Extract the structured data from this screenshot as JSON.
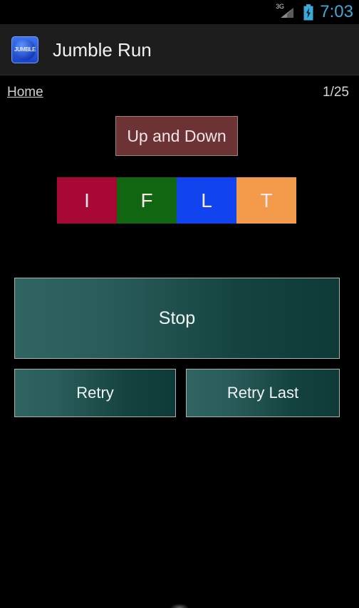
{
  "status_bar": {
    "network_label": "3G",
    "signal_icon": "signal-triangle-icon",
    "battery_icon": "battery-charging-icon",
    "clock": "7:03",
    "clock_color": "#3ea8d8"
  },
  "action_bar": {
    "app_icon": "app-logo-icon",
    "app_icon_text": "JUMBLE",
    "title": "Jumble Run",
    "background": "#1d1d1d"
  },
  "nav": {
    "home_label": "Home",
    "page_indicator": "1/25"
  },
  "puzzle": {
    "title": "Up and Down",
    "title_background": "#6d3234",
    "title_border": "#9b8286",
    "tiles": [
      {
        "letter": "I",
        "color": "#a80834"
      },
      {
        "letter": "F",
        "color": "#116611"
      },
      {
        "letter": "L",
        "color": "#1144ee"
      },
      {
        "letter": "T",
        "color": "#f39a4b"
      }
    ]
  },
  "controls": {
    "stop_label": "Stop",
    "retry_label": "Retry",
    "retry_last_label": "Retry Last",
    "button_gradient_start": "#2f6460",
    "button_gradient_end": "#0e3a37",
    "button_border": "#a9b2b2"
  }
}
